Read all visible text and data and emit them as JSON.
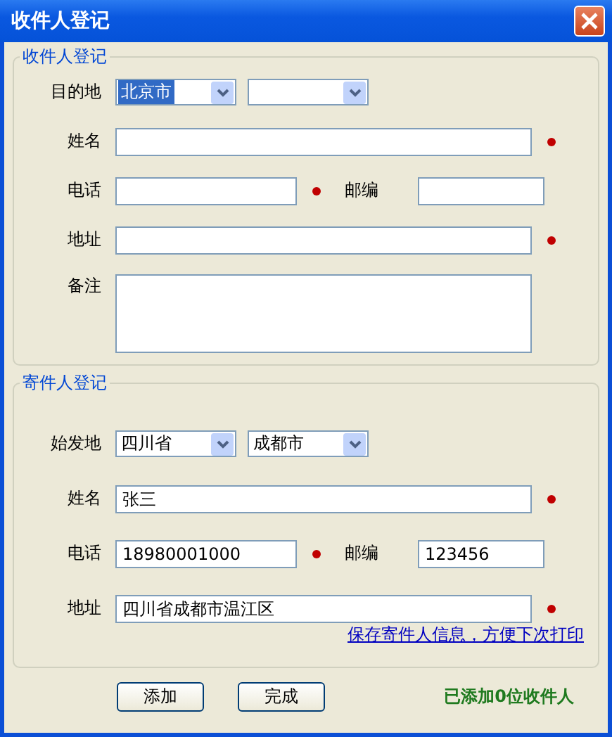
{
  "window": {
    "title": "收件人登记"
  },
  "sections": [
    {
      "legend": "收件人登记",
      "location": {
        "label": "目的地",
        "selects": [
          {
            "value": "北京市",
            "focused": true
          },
          {
            "focused": false
          }
        ]
      },
      "name": {
        "label": "姓名",
        "required": true
      },
      "phone": {
        "label": "电话",
        "required": true
      },
      "postal": {
        "label": "邮编"
      },
      "address": {
        "label": "地址",
        "required": true
      },
      "note": {
        "label": "备注"
      }
    },
    {
      "legend": "寄件人登记",
      "location": {
        "label": "始发地",
        "selects": [
          {
            "value": "四川省",
            "focused": false
          },
          {
            "value": "成都市",
            "focused": false
          }
        ]
      },
      "name": {
        "label": "姓名",
        "value": "张三",
        "required": true
      },
      "phone": {
        "label": "电话",
        "value": "18980001000",
        "required": true
      },
      "postal": {
        "label": "邮编",
        "value": "123456"
      },
      "address": {
        "label": "地址",
        "value": "四川省成都市温江区",
        "required": true
      },
      "link": "保存寄件人信息，方便下次打印"
    }
  ],
  "buttons": [
    "添加",
    "完成"
  ],
  "status": "已添加0位收件人"
}
